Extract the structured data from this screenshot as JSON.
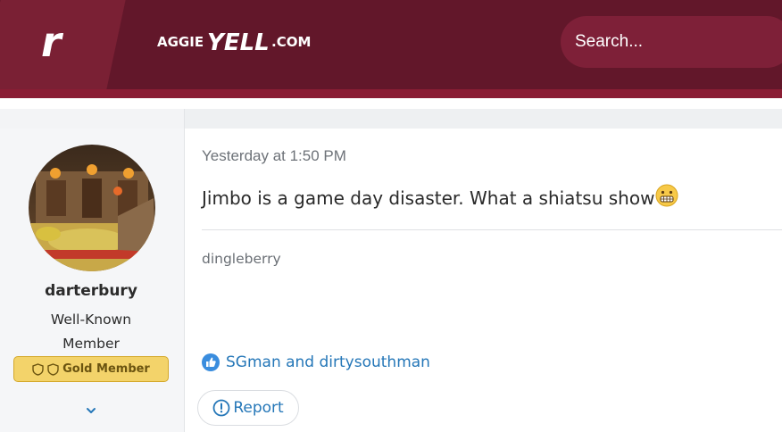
{
  "header": {
    "logo_letter": "r",
    "site_name": "AGGIEYELL.COM",
    "search_placeholder": "Search..."
  },
  "user": {
    "name": "darterbury",
    "title_line1": "Well-Known",
    "title_line2": "Member",
    "badge": "Gold Member"
  },
  "post": {
    "timestamp": "Yesterday at 1:50 PM",
    "body": "Jimbo is a game day disaster. What a shiatsu show",
    "signature": "dingleberry",
    "reactions": "SGman and dirtysouthman",
    "report_label": "Report"
  },
  "colors": {
    "header_bg": "#62172a",
    "search_bg": "#7e2038",
    "link": "#2577b8",
    "badge_bg": "#f3d36a"
  }
}
